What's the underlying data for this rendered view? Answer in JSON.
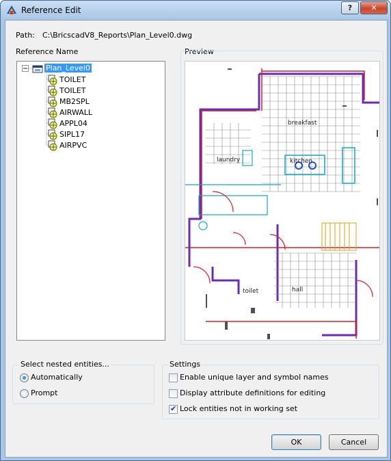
{
  "window": {
    "title": "Reference Edit",
    "help_label": "?",
    "close_label": "✕"
  },
  "path": {
    "label": "Path:",
    "value": "C:\\BricscadV8_Reports\\Plan_Level0.dwg"
  },
  "reference_name": {
    "label": "Reference Name",
    "root": "Plan_Level0",
    "items": [
      "TOILET",
      "TOILET",
      "MB2SPL",
      "AIRWALL",
      "APPL04",
      "SIPL17",
      "AIRPVC"
    ]
  },
  "preview": {
    "label": "Preview",
    "room_labels": [
      "breakfast",
      "laundry",
      "kitchen",
      "toilet",
      "hall"
    ]
  },
  "nested": {
    "label": "Select nested entities...",
    "options": [
      {
        "label": "Automatically",
        "selected": true
      },
      {
        "label": "Prompt",
        "selected": false
      }
    ]
  },
  "settings": {
    "label": "Settings",
    "options": [
      {
        "label": "Enable unique layer and symbol names",
        "checked": false
      },
      {
        "label": "Display attribute definitions for editing",
        "checked": false
      },
      {
        "label": "Lock entities not in working set",
        "checked": true
      }
    ]
  },
  "buttons": {
    "ok": "OK",
    "cancel": "Cancel"
  }
}
